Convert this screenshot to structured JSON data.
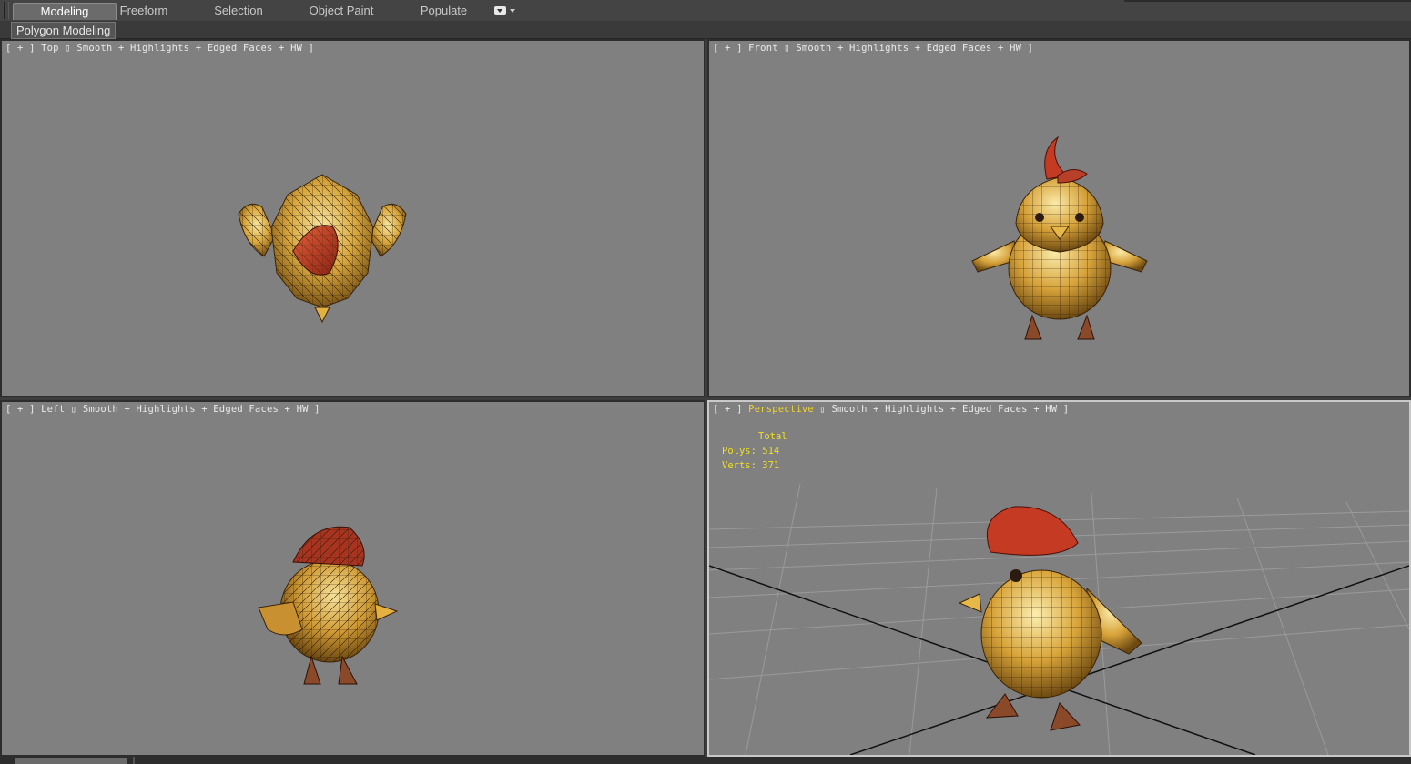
{
  "ribbon": {
    "tabs": [
      {
        "label": "Modeling",
        "active": true
      },
      {
        "label": "Freeform",
        "active": false
      },
      {
        "label": "Selection",
        "active": false
      },
      {
        "label": "Object Paint",
        "active": false
      },
      {
        "label": "Populate",
        "active": false
      }
    ],
    "panel_label": "Polygon Modeling"
  },
  "viewports": {
    "top": {
      "menu": "[ + ]",
      "view_name": "Top",
      "shading": "Smooth + Highlights + Edged Faces + HW ]"
    },
    "front": {
      "menu": "[ + ]",
      "view_name": "Front",
      "shading": "Smooth + Highlights + Edged Faces + HW ]"
    },
    "left": {
      "menu": "[ + ]",
      "view_name": "Left",
      "shading": "Smooth + Highlights + Edged Faces + HW ]"
    },
    "perspective": {
      "menu": "[ + ]",
      "view_name": "Perspective",
      "shading": "Smooth + Highlights + Edged Faces + HW ]",
      "active": true
    }
  },
  "stats": {
    "total_label": "Total",
    "polys_label": "Polys:",
    "polys": "514",
    "verts_label": "Verts:",
    "verts": "371"
  },
  "colors": {
    "viewport_bg": "#808080",
    "highlight_text": "#f3d32a",
    "model_body": "#d9a73c",
    "model_comb": "#c8442a"
  }
}
